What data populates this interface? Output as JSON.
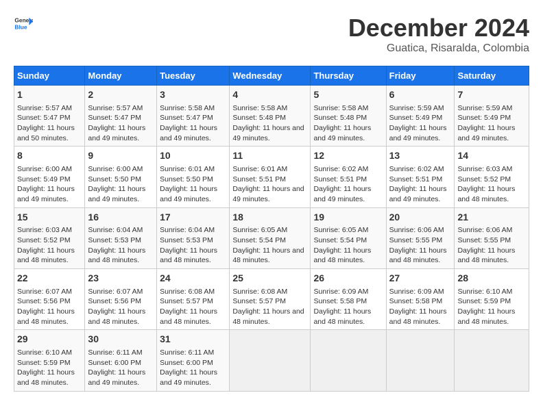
{
  "header": {
    "logo_line1": "General",
    "logo_line2": "Blue",
    "month_title": "December 2024",
    "subtitle": "Guatica, Risaralda, Colombia"
  },
  "weekdays": [
    "Sunday",
    "Monday",
    "Tuesday",
    "Wednesday",
    "Thursday",
    "Friday",
    "Saturday"
  ],
  "weeks": [
    [
      {
        "day": "1",
        "sunrise": "5:57 AM",
        "sunset": "5:47 PM",
        "daylight": "11 hours and 50 minutes."
      },
      {
        "day": "2",
        "sunrise": "5:57 AM",
        "sunset": "5:47 PM",
        "daylight": "11 hours and 49 minutes."
      },
      {
        "day": "3",
        "sunrise": "5:58 AM",
        "sunset": "5:47 PM",
        "daylight": "11 hours and 49 minutes."
      },
      {
        "day": "4",
        "sunrise": "5:58 AM",
        "sunset": "5:48 PM",
        "daylight": "11 hours and 49 minutes."
      },
      {
        "day": "5",
        "sunrise": "5:58 AM",
        "sunset": "5:48 PM",
        "daylight": "11 hours and 49 minutes."
      },
      {
        "day": "6",
        "sunrise": "5:59 AM",
        "sunset": "5:49 PM",
        "daylight": "11 hours and 49 minutes."
      },
      {
        "day": "7",
        "sunrise": "5:59 AM",
        "sunset": "5:49 PM",
        "daylight": "11 hours and 49 minutes."
      }
    ],
    [
      {
        "day": "8",
        "sunrise": "6:00 AM",
        "sunset": "5:49 PM",
        "daylight": "11 hours and 49 minutes."
      },
      {
        "day": "9",
        "sunrise": "6:00 AM",
        "sunset": "5:50 PM",
        "daylight": "11 hours and 49 minutes."
      },
      {
        "day": "10",
        "sunrise": "6:01 AM",
        "sunset": "5:50 PM",
        "daylight": "11 hours and 49 minutes."
      },
      {
        "day": "11",
        "sunrise": "6:01 AM",
        "sunset": "5:51 PM",
        "daylight": "11 hours and 49 minutes."
      },
      {
        "day": "12",
        "sunrise": "6:02 AM",
        "sunset": "5:51 PM",
        "daylight": "11 hours and 49 minutes."
      },
      {
        "day": "13",
        "sunrise": "6:02 AM",
        "sunset": "5:51 PM",
        "daylight": "11 hours and 49 minutes."
      },
      {
        "day": "14",
        "sunrise": "6:03 AM",
        "sunset": "5:52 PM",
        "daylight": "11 hours and 48 minutes."
      }
    ],
    [
      {
        "day": "15",
        "sunrise": "6:03 AM",
        "sunset": "5:52 PM",
        "daylight": "11 hours and 48 minutes."
      },
      {
        "day": "16",
        "sunrise": "6:04 AM",
        "sunset": "5:53 PM",
        "daylight": "11 hours and 48 minutes."
      },
      {
        "day": "17",
        "sunrise": "6:04 AM",
        "sunset": "5:53 PM",
        "daylight": "11 hours and 48 minutes."
      },
      {
        "day": "18",
        "sunrise": "6:05 AM",
        "sunset": "5:54 PM",
        "daylight": "11 hours and 48 minutes."
      },
      {
        "day": "19",
        "sunrise": "6:05 AM",
        "sunset": "5:54 PM",
        "daylight": "11 hours and 48 minutes."
      },
      {
        "day": "20",
        "sunrise": "6:06 AM",
        "sunset": "5:55 PM",
        "daylight": "11 hours and 48 minutes."
      },
      {
        "day": "21",
        "sunrise": "6:06 AM",
        "sunset": "5:55 PM",
        "daylight": "11 hours and 48 minutes."
      }
    ],
    [
      {
        "day": "22",
        "sunrise": "6:07 AM",
        "sunset": "5:56 PM",
        "daylight": "11 hours and 48 minutes."
      },
      {
        "day": "23",
        "sunrise": "6:07 AM",
        "sunset": "5:56 PM",
        "daylight": "11 hours and 48 minutes."
      },
      {
        "day": "24",
        "sunrise": "6:08 AM",
        "sunset": "5:57 PM",
        "daylight": "11 hours and 48 minutes."
      },
      {
        "day": "25",
        "sunrise": "6:08 AM",
        "sunset": "5:57 PM",
        "daylight": "11 hours and 48 minutes."
      },
      {
        "day": "26",
        "sunrise": "6:09 AM",
        "sunset": "5:58 PM",
        "daylight": "11 hours and 48 minutes."
      },
      {
        "day": "27",
        "sunrise": "6:09 AM",
        "sunset": "5:58 PM",
        "daylight": "11 hours and 48 minutes."
      },
      {
        "day": "28",
        "sunrise": "6:10 AM",
        "sunset": "5:59 PM",
        "daylight": "11 hours and 48 minutes."
      }
    ],
    [
      {
        "day": "29",
        "sunrise": "6:10 AM",
        "sunset": "5:59 PM",
        "daylight": "11 hours and 48 minutes."
      },
      {
        "day": "30",
        "sunrise": "6:11 AM",
        "sunset": "6:00 PM",
        "daylight": "11 hours and 49 minutes."
      },
      {
        "day": "31",
        "sunrise": "6:11 AM",
        "sunset": "6:00 PM",
        "daylight": "11 hours and 49 minutes."
      },
      null,
      null,
      null,
      null
    ]
  ]
}
